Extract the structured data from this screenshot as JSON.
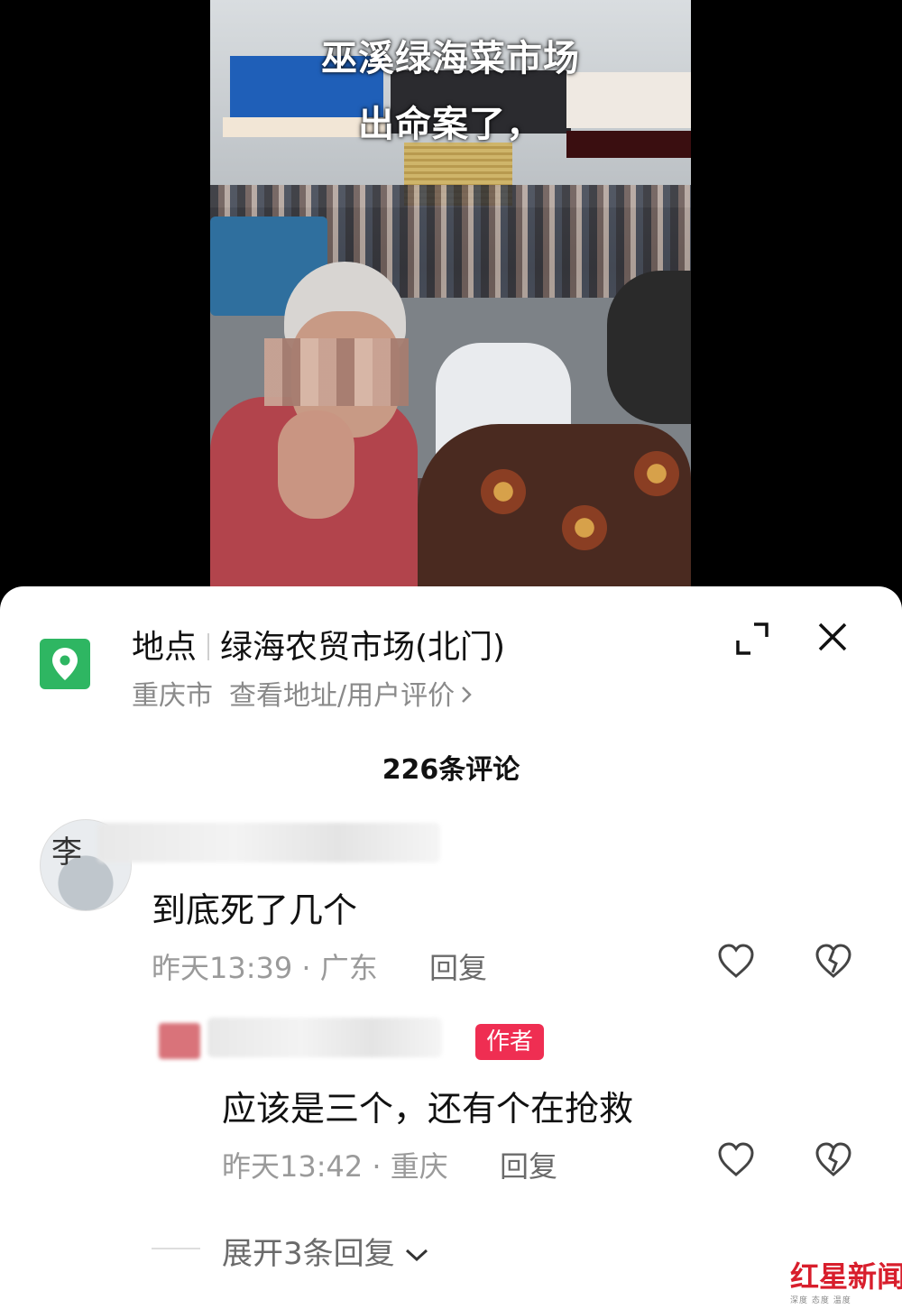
{
  "video": {
    "caption_line1": "巫溪绿海菜市场",
    "caption_line2": "出命案了，"
  },
  "location": {
    "label": "地点",
    "name": "绿海农贸市场(北门)",
    "city": "重庆市",
    "link": "查看地址/用户评价"
  },
  "comments_count": "226条评论",
  "comments": [
    {
      "text": "到底死了几个",
      "time": "昨天13:39 · 广东",
      "reply_label": "回复"
    }
  ],
  "reply": {
    "badge": "作者",
    "text": "应该是三个，还有个在抢救",
    "time": "昨天13:42 · 重庆",
    "reply_label": "回复"
  },
  "expand_replies": "展开3条回复",
  "watermark": {
    "brand": "红星新闻",
    "tagline": "深度 态度 温度"
  },
  "colors": {
    "location_green": "#2eb662",
    "author_badge": "#ef2e52",
    "watermark_red": "#d81e2c"
  }
}
